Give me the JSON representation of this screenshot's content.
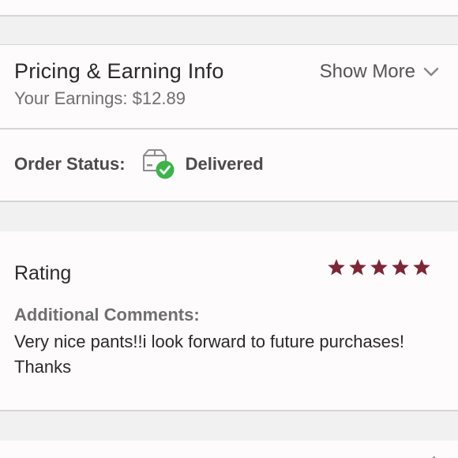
{
  "pricing": {
    "title": "Pricing & Earning Info",
    "earnings_label": "Your Earnings:",
    "earnings_value": "$12.89",
    "show_more_label": "Show More",
    "show_more_icon": "chevron-down-icon"
  },
  "order_status": {
    "label": "Order Status:",
    "value": "Delivered",
    "icon": "delivered-box-icon",
    "icon_accent": "#3cb44a"
  },
  "rating": {
    "title": "Rating",
    "stars": 5,
    "max_stars": 5,
    "star_color": "#7d2634",
    "comments_label": "Additional Comments:",
    "comments_text": "Very nice pants!!i look forward to future purchases! Thanks"
  }
}
